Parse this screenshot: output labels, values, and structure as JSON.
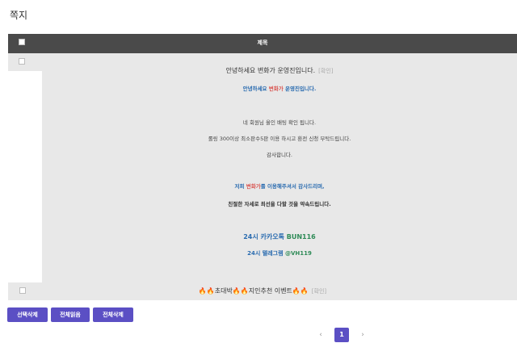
{
  "page": {
    "title": "쪽지"
  },
  "table": {
    "header_title": "제목"
  },
  "message1": {
    "subject": "안녕하세요 변화가 운영진입니다.",
    "confirm": "[확인]",
    "body": {
      "greeting_prefix": "안녕하세요 ",
      "greeting_brand": "변화가",
      "greeting_suffix": " 운영진입니다.",
      "line1": "네 회원님 올인 배팅 확인 됩니다.",
      "line2": "롤링 300이상 최소판수5판 이용 하시고 환전 신청 부탁드립니다.",
      "line3": "감사합니다.",
      "thanks_prefix": "저희 ",
      "thanks_brand": "변화가",
      "thanks_suffix": "를 이용해주셔서 감사드리며,",
      "promise": "친절한 자세로 최선을 다할 것을 약속드립니다.",
      "kakao_prefix": "24시 카카오톡 ",
      "kakao_id": "BUN116",
      "telegram_prefix": "24시 텔레그램 ",
      "telegram_id": "@VH119"
    }
  },
  "message2": {
    "fire": "🔥🔥",
    "part1": "초대박",
    "part2": "지인추천 이벤트",
    "confirm": "[확인]"
  },
  "actions": {
    "delete_selected": "선택삭제",
    "read_all": "전체읽음",
    "delete_all": "전체삭제"
  },
  "pagination": {
    "prev": "‹",
    "current": "1",
    "next": "›"
  },
  "colors": {
    "accent": "#5b4fc4",
    "header": "#4a4a4a",
    "row_bg": "#e8e8e8",
    "blue": "#2b6cb0",
    "green": "#2e8b57"
  }
}
